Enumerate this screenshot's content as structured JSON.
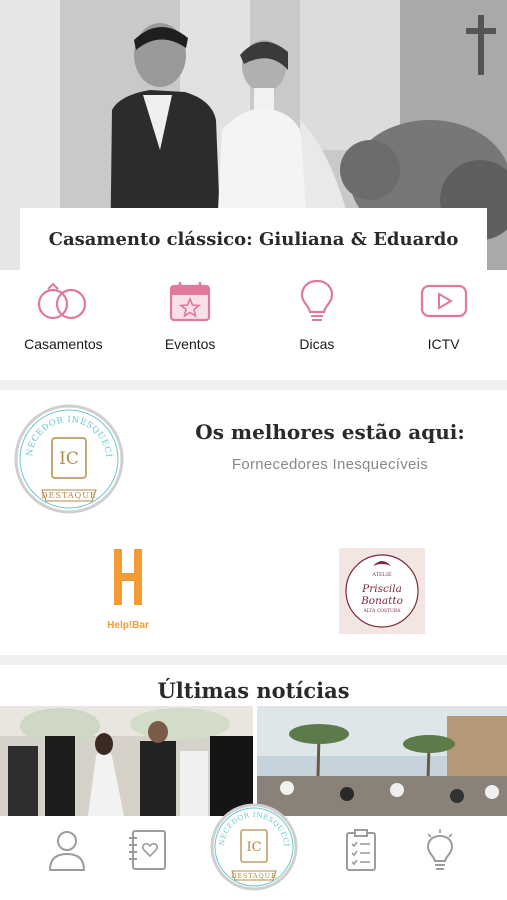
{
  "hero": {
    "title": "Casamento clássico: Giuliana & Eduardo"
  },
  "categories": [
    {
      "label": "Casamentos",
      "icon": "wedding-rings-icon"
    },
    {
      "label": "Eventos",
      "icon": "calendar-star-icon"
    },
    {
      "label": "Dicas",
      "icon": "lightbulb-icon"
    },
    {
      "label": "ICTV",
      "icon": "play-video-icon"
    }
  ],
  "best": {
    "title": "Os melhores estão aqui:",
    "subtitle": "Fornecedores Inesquecíveis",
    "seal": {
      "top_text": "FORNECEDOR INESQUECÍVEL",
      "bottom_text": "DESTAQUE",
      "monogram": "IC"
    },
    "logos": [
      {
        "name": "Help!Bar",
        "color": "#f39c34"
      },
      {
        "line1": "ATELIÊ",
        "name": "Priscila Bonatto",
        "line3": "ALTA COSTURA"
      }
    ]
  },
  "news": {
    "title": "Últimas notícias"
  },
  "tabbar": [
    "profile-icon",
    "notebook-heart-icon",
    "destaque-seal-icon",
    "checklist-icon",
    "lightbulb-icon"
  ],
  "colors": {
    "accent": "#e0799b",
    "seal_teal": "#6cc6cf",
    "seal_gold": "#b38a4a",
    "separator": "#efefef"
  }
}
